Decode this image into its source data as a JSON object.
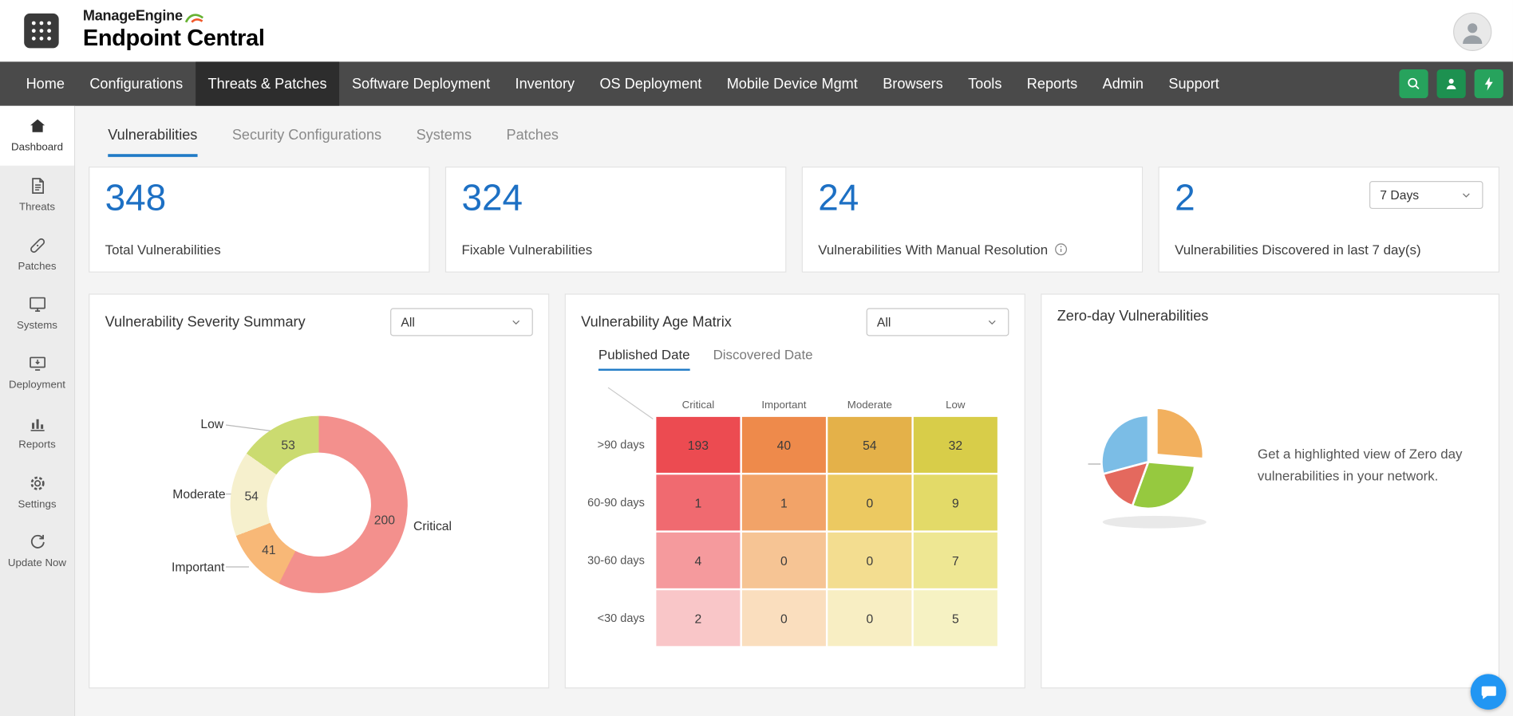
{
  "header": {
    "brand_top": "ManageEngine",
    "brand_name": "Endpoint Central"
  },
  "nav": {
    "items": [
      "Home",
      "Configurations",
      "Threats & Patches",
      "Software Deployment",
      "Inventory",
      "OS Deployment",
      "Mobile Device Mgmt",
      "Browsers",
      "Tools",
      "Reports",
      "Admin",
      "Support"
    ],
    "active": "Threats & Patches"
  },
  "sidebar": {
    "items": [
      "Dashboard",
      "Threats",
      "Patches",
      "Systems",
      "Deployment",
      "Reports",
      "Settings",
      "Update Now"
    ],
    "active": "Dashboard"
  },
  "tabs": {
    "items": [
      "Vulnerabilities",
      "Security Configurations",
      "Systems",
      "Patches"
    ],
    "active": "Vulnerabilities"
  },
  "stats": {
    "cards": [
      {
        "value": "348",
        "label": "Total Vulnerabilities"
      },
      {
        "value": "324",
        "label": "Fixable Vulnerabilities"
      },
      {
        "value": "24",
        "label": "Vulnerabilities With Manual Resolution"
      },
      {
        "value": "2",
        "label": "Vulnerabilities Discovered in last 7 day(s)",
        "range": "7 Days"
      }
    ]
  },
  "severity_summary": {
    "title": "Vulnerability Severity Summary",
    "filter_value": "All",
    "slices": [
      {
        "label": "Critical",
        "value": 200,
        "color": "#f3908d"
      },
      {
        "label": "Important",
        "value": 41,
        "color": "#f8b877"
      },
      {
        "label": "Moderate",
        "value": 54,
        "color": "#f6f0cd"
      },
      {
        "label": "Low",
        "value": 53,
        "color": "#cbdb70"
      }
    ]
  },
  "age_matrix": {
    "title": "Vulnerability Age Matrix",
    "filter_value": "All",
    "tabs": [
      "Published Date",
      "Discovered Date"
    ],
    "active_tab": "Published Date",
    "columns": [
      "Critical",
      "Important",
      "Moderate",
      "Low"
    ],
    "rows": [
      ">90 days",
      "60-90 days",
      "30-60 days",
      "<30 days"
    ],
    "values": [
      [
        193,
        40,
        54,
        32
      ],
      [
        1,
        1,
        0,
        9
      ],
      [
        4,
        0,
        0,
        7
      ],
      [
        2,
        0,
        0,
        5
      ]
    ],
    "cell_colors": [
      [
        "#ec4b51",
        "#ee8a4b",
        "#e4b149",
        "#d8cd49"
      ],
      [
        "#f06a70",
        "#f2a368",
        "#ecc961",
        "#e3da68"
      ],
      [
        "#f59a9d",
        "#f6c494",
        "#f3dd90",
        "#eee793"
      ],
      [
        "#f9c6c8",
        "#fadebe",
        "#f8eec3",
        "#f6f2c3"
      ]
    ]
  },
  "zero_day": {
    "title": "Zero-day Vulnerabilities",
    "description": "Get a highlighted view of Zero day vulnerabilities in your network."
  },
  "colors": {
    "accent_blue": "#1d70c4",
    "nav_background": "#4a4a4a",
    "nav_active": "#2d2d2d",
    "action_green": "#27a35d",
    "tab_underline": "#1f7ac6",
    "chat_fab": "#2196f3"
  },
  "chart_data": [
    {
      "type": "pie",
      "title": "Vulnerability Severity Summary",
      "categories": [
        "Critical",
        "Important",
        "Moderate",
        "Low"
      ],
      "values": [
        200,
        41,
        54,
        53
      ],
      "legend_position": "callout-labels",
      "donut": true
    },
    {
      "type": "heatmap",
      "title": "Vulnerability Age Matrix",
      "x": [
        "Critical",
        "Important",
        "Moderate",
        "Low"
      ],
      "y": [
        ">90 days",
        "60-90 days",
        "30-60 days",
        "<30 days"
      ],
      "values": [
        [
          193,
          40,
          54,
          32
        ],
        [
          1,
          1,
          0,
          9
        ],
        [
          4,
          0,
          0,
          7
        ],
        [
          2,
          0,
          0,
          5
        ]
      ]
    }
  ]
}
